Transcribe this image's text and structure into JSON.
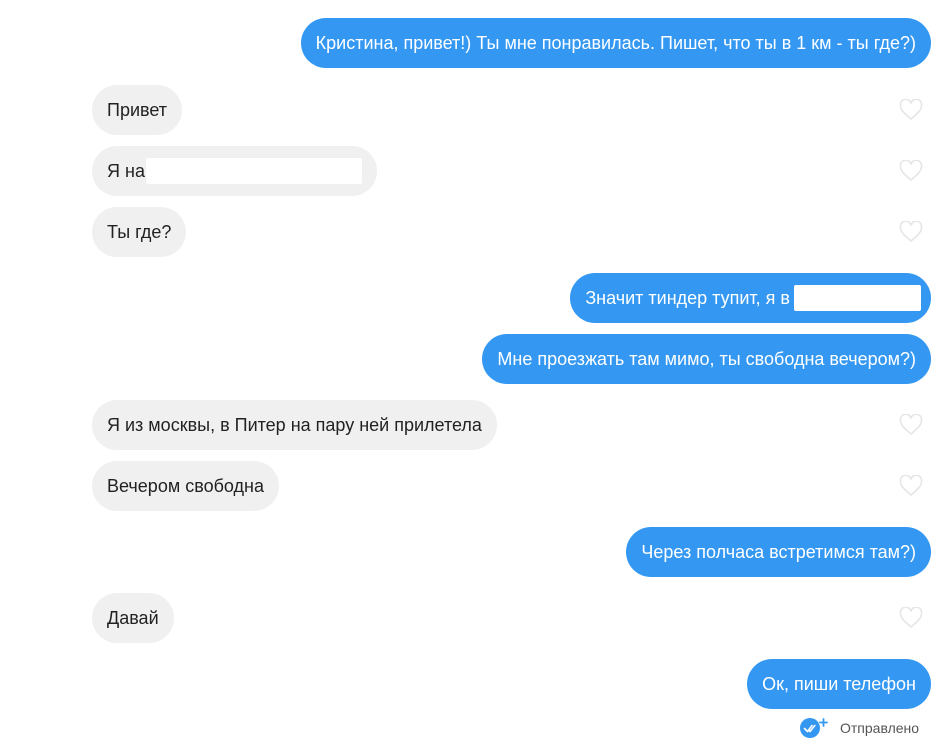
{
  "conversation": {
    "messages": [
      {
        "direction": "outgoing",
        "text": "Кристина, привет!) Ты мне понравилась. Пишет, что ты в 1 км - ты где?)"
      },
      {
        "direction": "incoming",
        "text": "Привет"
      },
      {
        "direction": "incoming",
        "text": "Я на"
      },
      {
        "direction": "incoming",
        "text": "Ты где?"
      },
      {
        "direction": "outgoing",
        "text": "Значит тиндер тупит, я в"
      },
      {
        "direction": "outgoing",
        "text": "Мне проезжать там мимо, ты свободна вечером?)"
      },
      {
        "direction": "incoming",
        "text": "Я из москвы, в Питер на пару ней прилетела"
      },
      {
        "direction": "incoming",
        "text": "Вечером свободна"
      },
      {
        "direction": "outgoing",
        "text": "Через полчаса встретимся там?)"
      },
      {
        "direction": "incoming",
        "text": "Давай"
      },
      {
        "direction": "outgoing",
        "text": "Ок, пиши телефон"
      }
    ],
    "status": {
      "icon": "double-check-icon",
      "label": "Отправлено"
    }
  },
  "colors": {
    "outgoing_bubble": "#3498f2",
    "incoming_bubble": "#f0f0f0",
    "status_icon": "#3498f2",
    "like_icon": "#e6e6e6"
  }
}
